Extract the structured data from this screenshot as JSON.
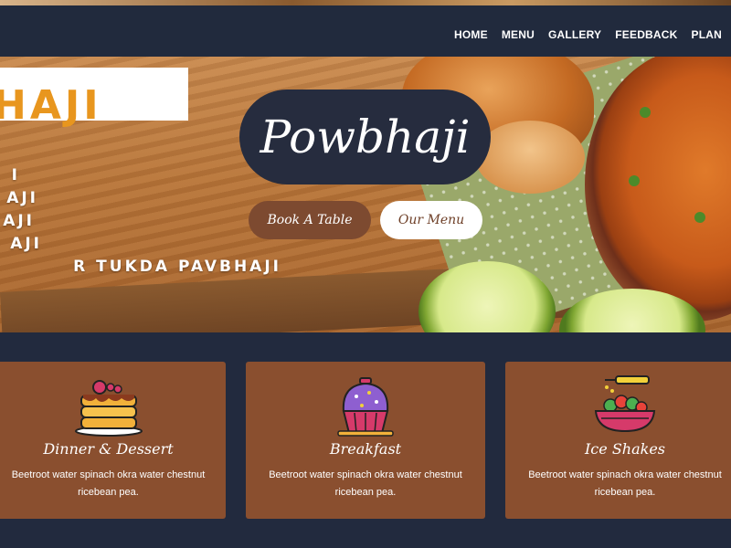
{
  "nav": {
    "items": [
      "HOME",
      "MENU",
      "GALLERY",
      "FEEDBACK",
      "PLAN"
    ]
  },
  "hero": {
    "logo_text": "HAJI",
    "menu_lines": [
      "I",
      "AJI",
      "AJI",
      "AJI",
      "R TUKDA PAVBHAJI"
    ],
    "title": "Powbhaji",
    "book_button": "Book A Table",
    "menu_button": "Our Menu"
  },
  "services": [
    {
      "title": "Dinner & Dessert",
      "text": "Beetroot water spinach okra water chestnut ricebean pea.",
      "icon": "pancake-icon"
    },
    {
      "title": "Breakfast",
      "text": "Beetroot water spinach okra water chestnut ricebean pea.",
      "icon": "cupcake-icon"
    },
    {
      "title": "Ice Shakes",
      "text": "Beetroot water spinach okra water chestnut ricebean pea.",
      "icon": "salad-bowl-icon"
    }
  ],
  "colors": {
    "navbar": "#212a3d",
    "card": "#8a4f2f",
    "accent_orange": "#e8961e",
    "book_button": "#7d4a30"
  }
}
